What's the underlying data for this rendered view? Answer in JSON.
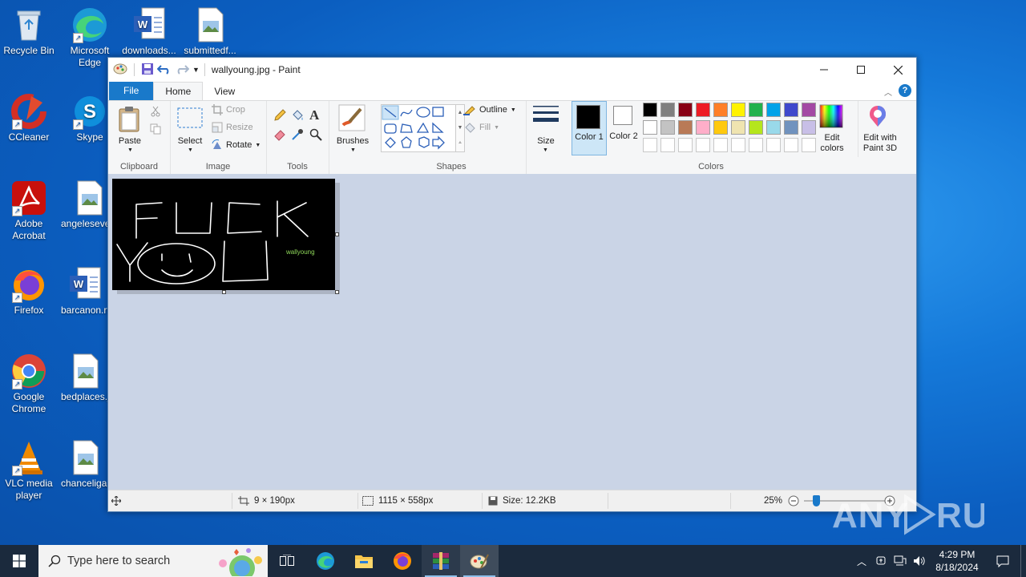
{
  "desktop": {
    "icons": [
      {
        "label": "Recycle Bin",
        "icon": "recycle-bin-icon"
      },
      {
        "label": "Microsoft Edge",
        "icon": "edge-icon"
      },
      {
        "label": "downloads...",
        "icon": "word-doc-icon"
      },
      {
        "label": "submittedf...",
        "icon": "image-file-icon"
      },
      {
        "label": "CCleaner",
        "icon": "ccleaner-icon"
      },
      {
        "label": "Skype",
        "icon": "skype-icon"
      },
      {
        "label": "Adobe Acrobat",
        "icon": "acrobat-icon"
      },
      {
        "label": "angelesevents.jpg",
        "icon": "image-file-icon"
      },
      {
        "label": "Firefox",
        "icon": "firefox-icon"
      },
      {
        "label": "barcanon.rtf",
        "icon": "word-doc-icon"
      },
      {
        "label": "Google Chrome",
        "icon": "chrome-icon"
      },
      {
        "label": "bedplaces.jpg",
        "icon": "image-file-icon"
      },
      {
        "label": "VLC media player",
        "icon": "vlc-icon"
      },
      {
        "label": "chanceliga.jpg",
        "icon": "image-file-icon"
      }
    ]
  },
  "window": {
    "title": "wallyoung.jpg - Paint",
    "tabs": {
      "file": "File",
      "home": "Home",
      "view": "View"
    },
    "ribbon": {
      "clipboard": {
        "name": "Clipboard",
        "paste": "Paste"
      },
      "image": {
        "name": "Image",
        "select": "Select",
        "crop": "Crop",
        "resize": "Resize",
        "rotate": "Rotate"
      },
      "tools": {
        "name": "Tools"
      },
      "brushes": {
        "label": "Brushes"
      },
      "shapes": {
        "name": "Shapes",
        "outline": "Outline",
        "fill": "Fill"
      },
      "size": {
        "label": "Size"
      },
      "colors": {
        "name": "Colors",
        "color1": "Color 1",
        "color2": "Color 2",
        "edit_colors": "Edit colors",
        "paint3d": "Edit with Paint 3D",
        "color1_value": "#000000",
        "color2_value": "#ffffff",
        "palette_row1": [
          "#000000",
          "#7f7f7f",
          "#880015",
          "#ed1c24",
          "#ff7f27",
          "#fff200",
          "#22b14c",
          "#00a2e8",
          "#3f48cc",
          "#a349a4"
        ],
        "palette_row2": [
          "#ffffff",
          "#c3c3c3",
          "#b97a57",
          "#ffaec9",
          "#ffc90e",
          "#efe4b0",
          "#b5e61d",
          "#99d9ea",
          "#7092be",
          "#c8bfe7"
        ],
        "palette_row3": [
          "#ffffff",
          "#ffffff",
          "#ffffff",
          "#ffffff",
          "#ffffff",
          "#ffffff",
          "#ffffff",
          "#ffffff",
          "#ffffff",
          "#ffffff"
        ]
      }
    },
    "canvas": {
      "drawn_text": "FUCK YOU",
      "signature": "wallyoung"
    },
    "status": {
      "cursor_pos": "9 × 190px",
      "selection_size": "1115 × 558px",
      "file_size": "Size: 12.2KB",
      "zoom": "25%"
    }
  },
  "taskbar": {
    "search_placeholder": "Type here to search",
    "time": "4:29 PM",
    "date": "8/18/2024"
  },
  "watermark": "ANY RUN"
}
